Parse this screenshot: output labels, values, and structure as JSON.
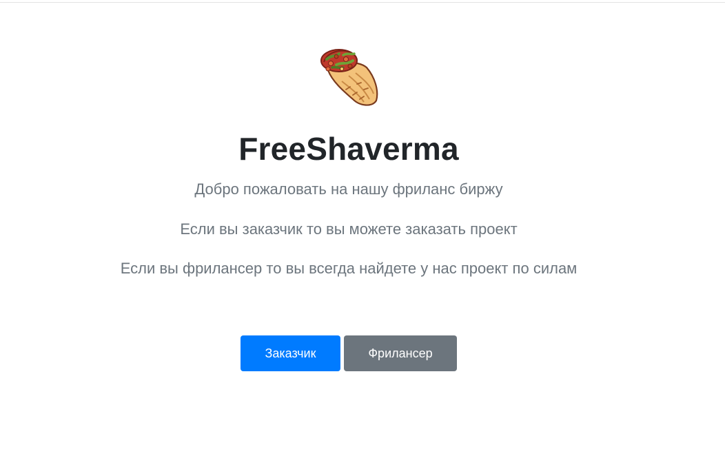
{
  "hero": {
    "logo_icon": "shawarma-icon",
    "title": "FreeShaverma",
    "lines": [
      "Добро пожаловать на нашу фриланс биржу",
      "Если вы заказчик то вы можете заказать проект",
      "Если вы фрилансер то вы всегда найдете у нас проект по силам"
    ]
  },
  "actions": {
    "customer_label": "Заказчик",
    "freelancer_label": "Фрилансер"
  },
  "colors": {
    "primary": "#007bff",
    "secondary": "#6c757d",
    "title": "#212529",
    "muted": "#6c757d"
  }
}
